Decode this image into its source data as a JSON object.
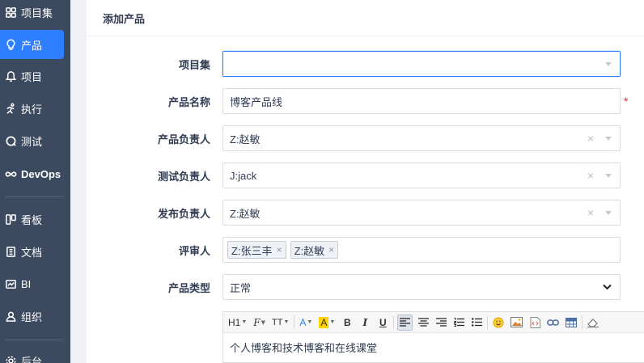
{
  "sidebar": {
    "items": [
      {
        "label": "项目集",
        "icon": "grid-icon"
      },
      {
        "label": "产品",
        "icon": "lightbulb-icon"
      },
      {
        "label": "项目",
        "icon": "bell-icon"
      },
      {
        "label": "执行",
        "icon": "run-icon"
      },
      {
        "label": "测试",
        "icon": "bug-icon"
      },
      {
        "label": "DevOps",
        "icon": "infinity-icon"
      },
      {
        "label": "看板",
        "icon": "kanban-icon"
      },
      {
        "label": "文档",
        "icon": "document-icon"
      },
      {
        "label": "BI",
        "icon": "chart-icon"
      },
      {
        "label": "组织",
        "icon": "user-icon"
      },
      {
        "label": "后台",
        "icon": "gear-icon"
      }
    ],
    "active_index": 1,
    "active_color": "#2e7fff"
  },
  "page": {
    "title": "添加产品"
  },
  "form": {
    "program_label": "项目集",
    "program_value": "",
    "name_label": "产品名称",
    "name_value": "博客产品线",
    "required_mark": "*",
    "po_label": "产品负责人",
    "po_value": "Z:赵敏",
    "qd_label": "测试负责人",
    "qd_value": "J:jack",
    "rd_label": "发布负责人",
    "rd_value": "Z:赵敏",
    "reviewer_label": "评审人",
    "reviewers": [
      "Z:张三丰",
      "Z:赵敏"
    ],
    "type_label": "产品类型",
    "type_value": "正常",
    "clear_symbol": "×",
    "tag_remove_symbol": "×"
  },
  "editor": {
    "content": "个人博客和技术博客和在线课堂",
    "toolbar": [
      "H1",
      "F",
      "TT",
      "A",
      "A",
      "B",
      "I",
      "U"
    ]
  }
}
